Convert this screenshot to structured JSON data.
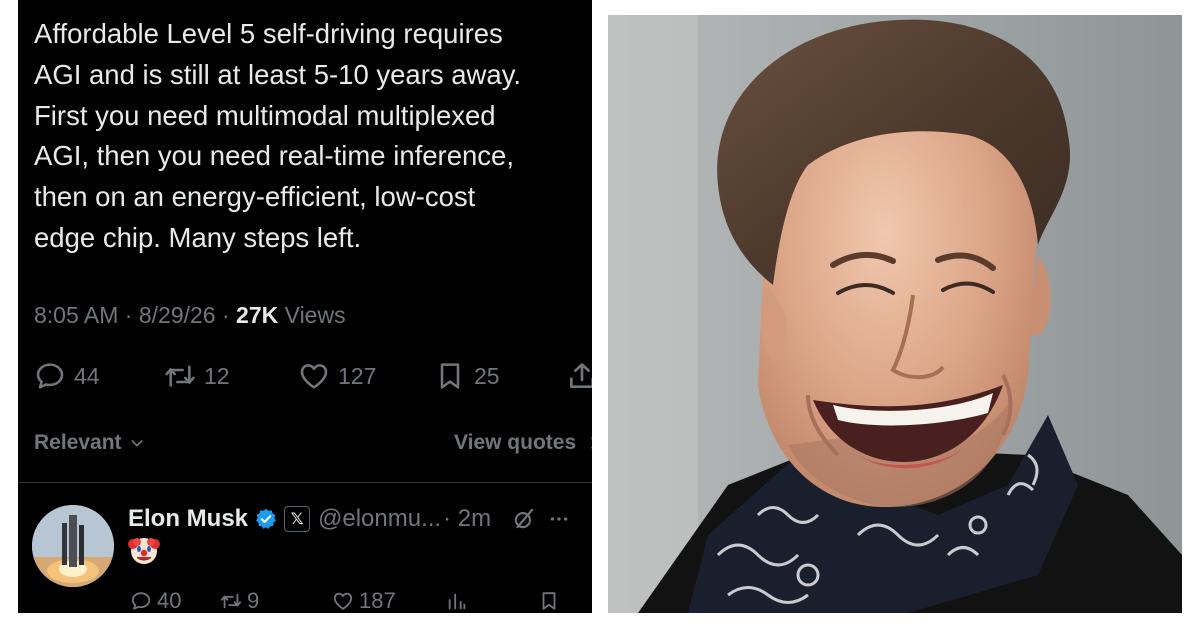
{
  "tweet": {
    "text": "Affordable Level 5 self-driving requires\nAGI and is still at least 5-10 years away.\nFirst you need multimodal multiplexed\nAGI, then you need real-time inference,\nthen on an energy-efficient, low-cost\nedge chip. Many steps left.",
    "time": "8:05 AM",
    "date": "8/29/26",
    "views_count": "27K",
    "views_label": "Views",
    "stats": {
      "replies": "44",
      "reposts": "12",
      "likes": "127",
      "bookmarks": "25"
    }
  },
  "replies_section": {
    "sort_label": "Relevant",
    "quotes_label": "View quotes"
  },
  "reply": {
    "name": "Elon Musk",
    "badge": "𝕏",
    "handle": "@elonmu...",
    "time": "· 2m",
    "stats": {
      "replies": "40",
      "reposts": "9",
      "likes": "187"
    }
  },
  "colors": {
    "background": "#000000",
    "text": "#e7e9ea",
    "muted": "#71767b",
    "verified": "#1d9bf0",
    "divider": "#2f3336"
  },
  "icons": [
    "reply-icon",
    "repost-icon",
    "like-icon",
    "bookmark-icon",
    "share-icon",
    "chevron-down-icon",
    "chevron-right-icon",
    "verified-icon",
    "grok-icon",
    "more-icon",
    "clown-emoji-icon"
  ]
}
